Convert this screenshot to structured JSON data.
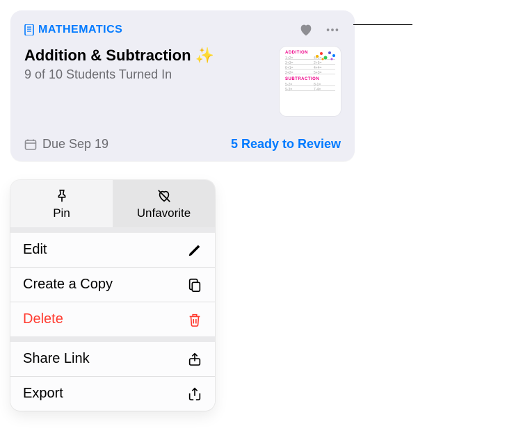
{
  "card": {
    "subject": "MATHEMATICS",
    "title": "Addition & Subtraction ✨",
    "subtitle": "9 of 10 Students Turned In",
    "due_label": "Due Sep 19",
    "review_label": "5 Ready to Review",
    "thumb": {
      "heading1": "ADDITION",
      "heading2": "SUBTRACTION"
    }
  },
  "menu": {
    "pin_label": "Pin",
    "unfavorite_label": "Unfavorite",
    "rows": {
      "edit": "Edit",
      "copy": "Create a Copy",
      "delete": "Delete",
      "share": "Share Link",
      "export": "Export"
    }
  }
}
